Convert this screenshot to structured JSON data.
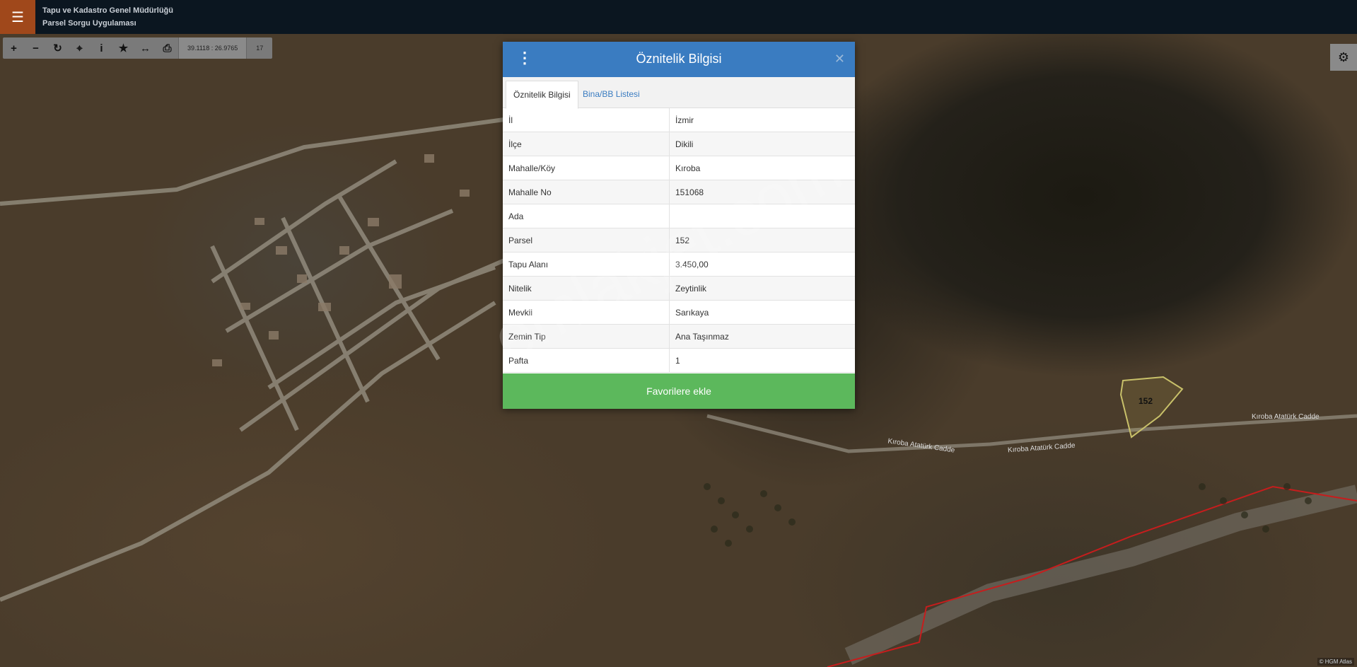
{
  "header": {
    "org_name": "Tapu ve Kadastro Genel Müdürlüğü",
    "app_name": "Parsel Sorgu Uygulaması",
    "menu_icon": "hamburger-icon",
    "accent_color": "#a0481b"
  },
  "map_toolbar": {
    "tools": [
      "zoom-in-icon",
      "zoom-out-icon",
      "refresh-icon",
      "locate-icon",
      "info-icon",
      "favorite-star-icon",
      "measure-icon",
      "print-icon"
    ],
    "coordinates": "39.1118 : 26.9765",
    "zoom_level": "17"
  },
  "map": {
    "parcel_label": "152",
    "road_labels": [
      "Kıroba Atatürk Cadde",
      "Kıroba Atatürk Cadde",
      "Kıroba Atatürk Cadde"
    ],
    "attribution": "© HGM Atlas"
  },
  "dialog": {
    "title": "Öznitelik Bilgisi",
    "tabs": [
      "Öznitelik Bilgisi",
      "Bina/BB Listesi"
    ],
    "rows": [
      {
        "key": "İl",
        "value": "İzmir"
      },
      {
        "key": "İlçe",
        "value": "Dikili"
      },
      {
        "key": "Mahalle/Köy",
        "value": "Kıroba"
      },
      {
        "key": "Mahalle No",
        "value": "151068"
      },
      {
        "key": "Ada",
        "value": ""
      },
      {
        "key": "Parsel",
        "value": "152"
      },
      {
        "key": "Tapu Alanı",
        "value": "3.450,00"
      },
      {
        "key": "Nitelik",
        "value": "Zeytinlik"
      },
      {
        "key": "Mevkii",
        "value": "Sarıkaya"
      },
      {
        "key": "Zemin Tip",
        "value": "Ana Taşınmaz"
      },
      {
        "key": "Pafta",
        "value": "1"
      }
    ],
    "favorite_button": "Favorilere ekle",
    "header_color": "#3a7cc1",
    "button_color": "#5cb85c"
  },
  "watermark": "emlakjet.com"
}
